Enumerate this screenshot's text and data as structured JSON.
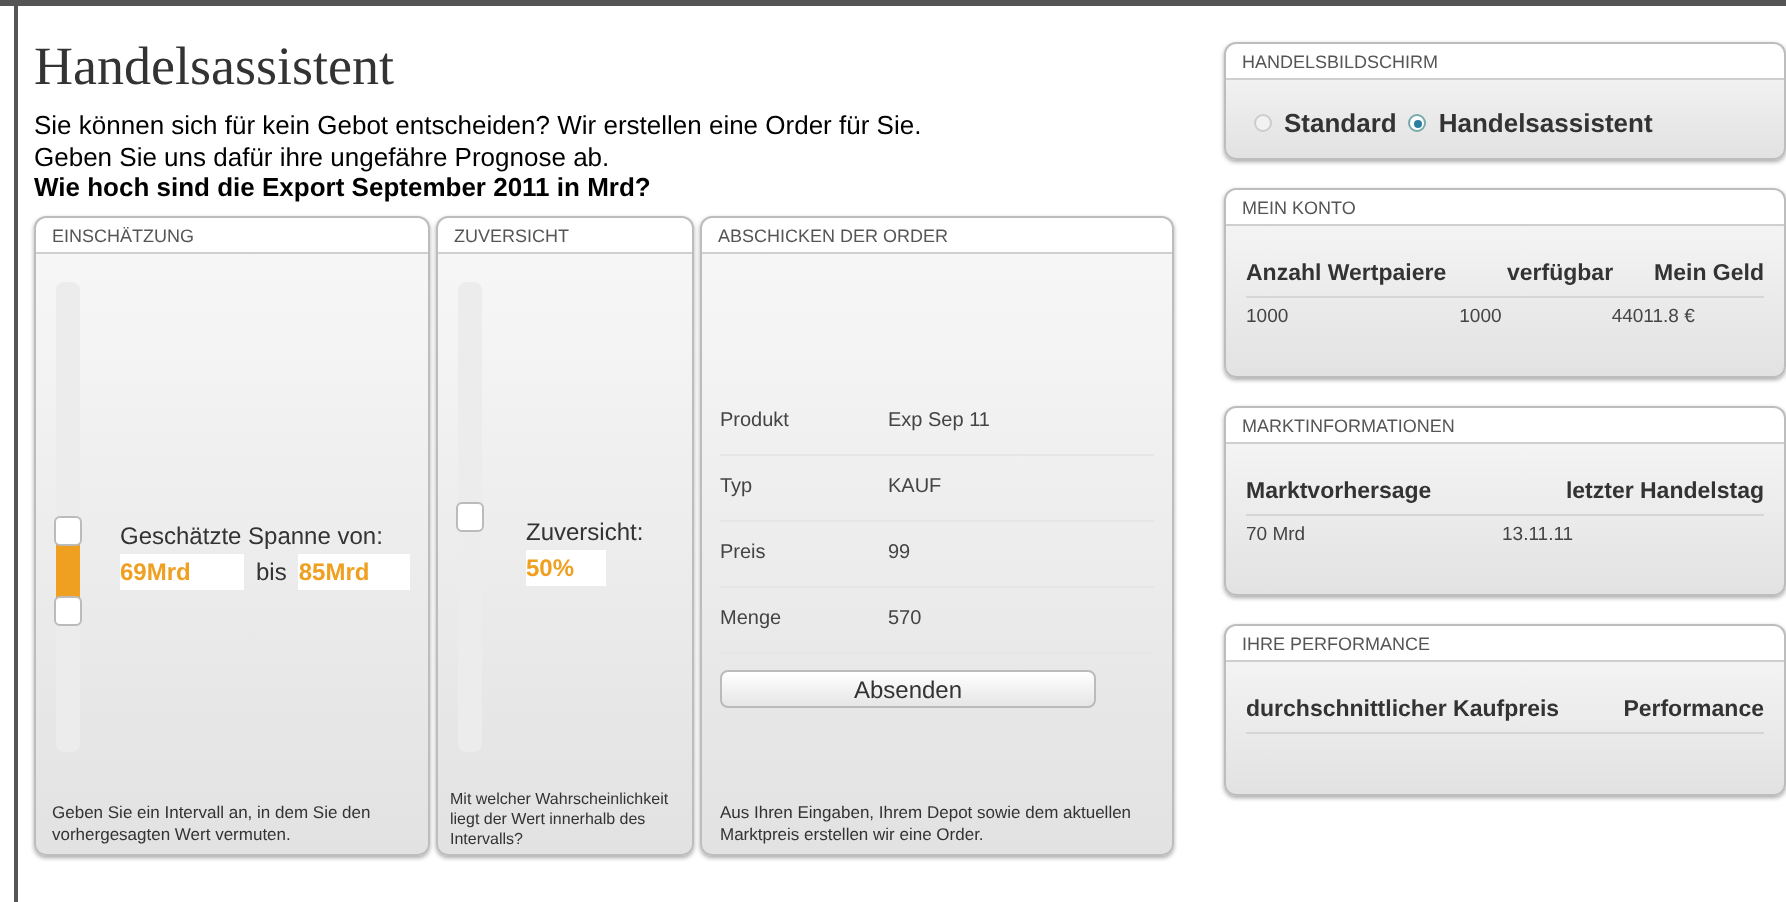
{
  "title": "Handelsassistent",
  "intro": [
    "Sie können sich für kein Gebot entscheiden? Wir erstellen eine Order für Sie.",
    "Geben Sie uns dafür ihre ungefähre Prognose ab."
  ],
  "question": "Wie hoch sind die Export September 2011 in Mrd?",
  "estimate": {
    "header": "EINSCHÄTZUNG",
    "range": [
      {
        "level": 0.3
      },
      {
        "level": 0.47
      }
    ],
    "label": "Geschätzte Spanne von:",
    "from": "69Mrd",
    "to_label": "bis",
    "to": "85Mrd",
    "hint": "Geben Sie ein Intervall an, in dem Sie den vorhergesagten Wert vermuten."
  },
  "confidence": {
    "header": "ZUVERSICHT",
    "level": 0.5,
    "label": "Zuversicht:",
    "value": "50%",
    "hint": "Mit welcher Wahrscheinlichkeit liegt der Wert innerhalb des Intervalls?"
  },
  "order": {
    "header": "ABSCHICKEN DER ORDER",
    "rows": [
      {
        "label": "Produkt",
        "value": "Exp Sep 11"
      },
      {
        "label": "Typ",
        "value": "KAUF"
      },
      {
        "label": "Preis",
        "value": "99"
      },
      {
        "label": "Menge",
        "value": "570"
      }
    ],
    "button": "Absenden",
    "hint": "Aus Ihren Eingaben, Ihrem Depot sowie dem aktuellen Marktpreis erstellen wir eine Order."
  },
  "screen_mode": {
    "header": "HANDELSBILDSCHIRM",
    "options": [
      {
        "label": "Standard",
        "selected": false
      },
      {
        "label": "Handelsassistent",
        "selected": true
      }
    ]
  },
  "tables": [
    {
      "header": "MEIN KONTO",
      "columns": [
        "Anzahl Wertpaiere",
        "verfügbar",
        "Mein Geld"
      ],
      "rows": [
        [
          "1000",
          "1000",
          "44011.8 €"
        ]
      ]
    },
    {
      "header": "MARKTINFORMATIONEN",
      "columns": [
        "Marktvorhersage",
        "letzter Handelstag"
      ],
      "rows": [
        [
          "70 Mrd",
          "13.11.11"
        ]
      ]
    },
    {
      "header": "IHRE PERFORMANCE",
      "columns": [
        "durchschnittlicher Kaufpreis",
        "Performance"
      ]
    }
  ]
}
